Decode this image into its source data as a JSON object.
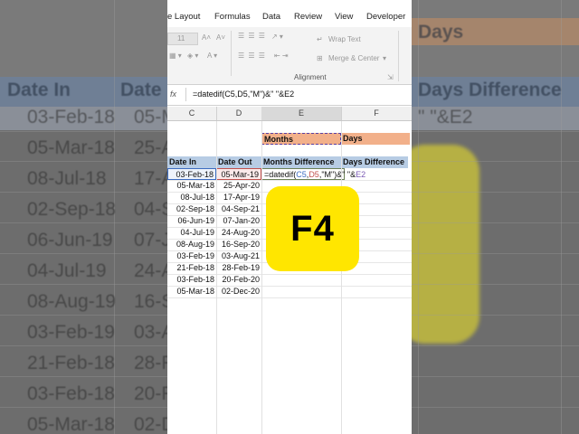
{
  "ribbon": {
    "tabs": [
      "e Layout",
      "Formulas",
      "Data",
      "Review",
      "View",
      "Developer"
    ],
    "font_size": "11",
    "wrap_text": "Wrap Text",
    "merge_center": "Merge & Center",
    "alignment_label": "Alignment"
  },
  "formula_bar": {
    "fx_label": "fx",
    "formula": "=datedif(C5,D5,\"M\")&\" \"&E2"
  },
  "columns": [
    "C",
    "D",
    "E",
    "F"
  ],
  "labels": {
    "months": "Months",
    "days": "Days"
  },
  "table": {
    "headers": [
      "Date In",
      "Date Out",
      "Months Difference",
      "Days Difference"
    ],
    "rows": [
      [
        "03-Feb-18",
        "05-Mar-19"
      ],
      [
        "05-Mar-18",
        "25-Apr-20"
      ],
      [
        "08-Jul-18",
        "17-Apr-19"
      ],
      [
        "02-Sep-18",
        "04-Sep-21"
      ],
      [
        "06-Jun-19",
        "07-Jan-20"
      ],
      [
        "04-Jul-19",
        "24-Aug-20"
      ],
      [
        "08-Aug-19",
        "16-Sep-20"
      ],
      [
        "03-Feb-19",
        "03-Aug-21"
      ],
      [
        "21-Feb-18",
        "28-Feb-19"
      ],
      [
        "03-Feb-18",
        "20-Feb-20"
      ],
      [
        "05-Mar-18",
        "02-Dec-20"
      ]
    ],
    "editing_formula": {
      "prefix": "=datedif(",
      "ref1": "C5",
      "sep1": ",",
      "ref2": "D5",
      "mid": ",\"M\")&\" \"&",
      "ref3": "E2"
    }
  },
  "background": {
    "header_date_in": "Date In",
    "header_date_out": "Date",
    "header_days_diff": "Days Difference",
    "days": "Days",
    "formula_tail": "\" \"&E2",
    "dates_in": [
      "03-Feb-18",
      "05-Mar-18",
      "08-Jul-18",
      "02-Sep-18",
      "06-Jun-19",
      "04-Jul-19",
      "08-Aug-19",
      "03-Feb-19",
      "21-Feb-18",
      "03-Feb-18",
      "05-Mar-18"
    ],
    "dates_out_partial": [
      "05-M",
      "25-A",
      "17-A",
      "04-S",
      "07-J",
      "24-A",
      "16-S",
      "03-A",
      "28-F",
      "20-F",
      "02-D"
    ]
  },
  "badge": {
    "key": "F4"
  },
  "colors": {
    "badge": "#ffe600",
    "header_blue": "#b7cce4",
    "days_orange": "#f2b08a",
    "ref_blue": "#3d6cc0",
    "ref_red": "#c0504d"
  }
}
